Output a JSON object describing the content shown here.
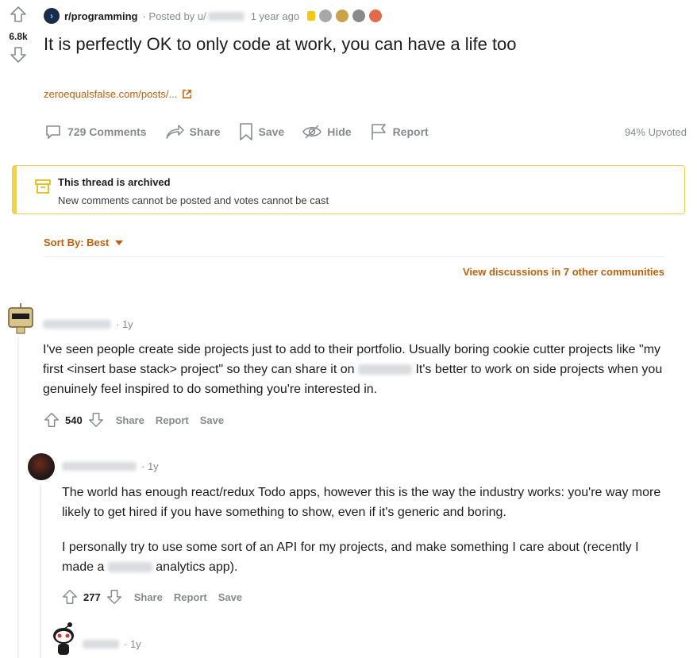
{
  "post": {
    "score": "6.8k",
    "subreddit": "r/programming",
    "posted_by_prefix": "· Posted by u/",
    "time": "1 year ago",
    "title": "It is perfectly OK to only code at work, you can have a life too",
    "link": "zeroequalsfalse.com/posts/...",
    "actions": {
      "comments": "729 Comments",
      "share": "Share",
      "save": "Save",
      "hide": "Hide",
      "report": "Report"
    },
    "upvoted": "94% Upvoted"
  },
  "archived": {
    "title": "This thread is archived",
    "message": "New comments cannot be posted and votes cannot be cast"
  },
  "sort_label": "Sort By: Best",
  "view_discussions": "View discussions in 7 other communities",
  "comments": [
    {
      "time": "· 1y",
      "body_before": "I've seen people create side projects just to add to their portfolio. Usually boring cookie cutter projects like \"my first <insert base stack> project\" so they can share it on",
      "body_after": " It's better to work on side projects when you genuinely feel inspired to do something you're interested in.",
      "score": "540",
      "share": "Share",
      "report": "Report",
      "save": "Save"
    },
    {
      "time": "· 1y",
      "para1": "The world has enough react/redux Todo apps, however this is the way the industry works: you're way more likely to get hired if you have something to show, even if it's generic and boring.",
      "para2_before": "I personally try to use some sort of an API for my projects, and make something I care about (recently I made a",
      "para2_after": " analytics app).",
      "score": "277",
      "share": "Share",
      "report": "Report",
      "save": "Save"
    },
    {
      "time": "· 1y"
    }
  ],
  "colors": {
    "accent_orange": "#bf5e0c",
    "archived_border": "#f0d250",
    "muted": "#878a8c"
  }
}
